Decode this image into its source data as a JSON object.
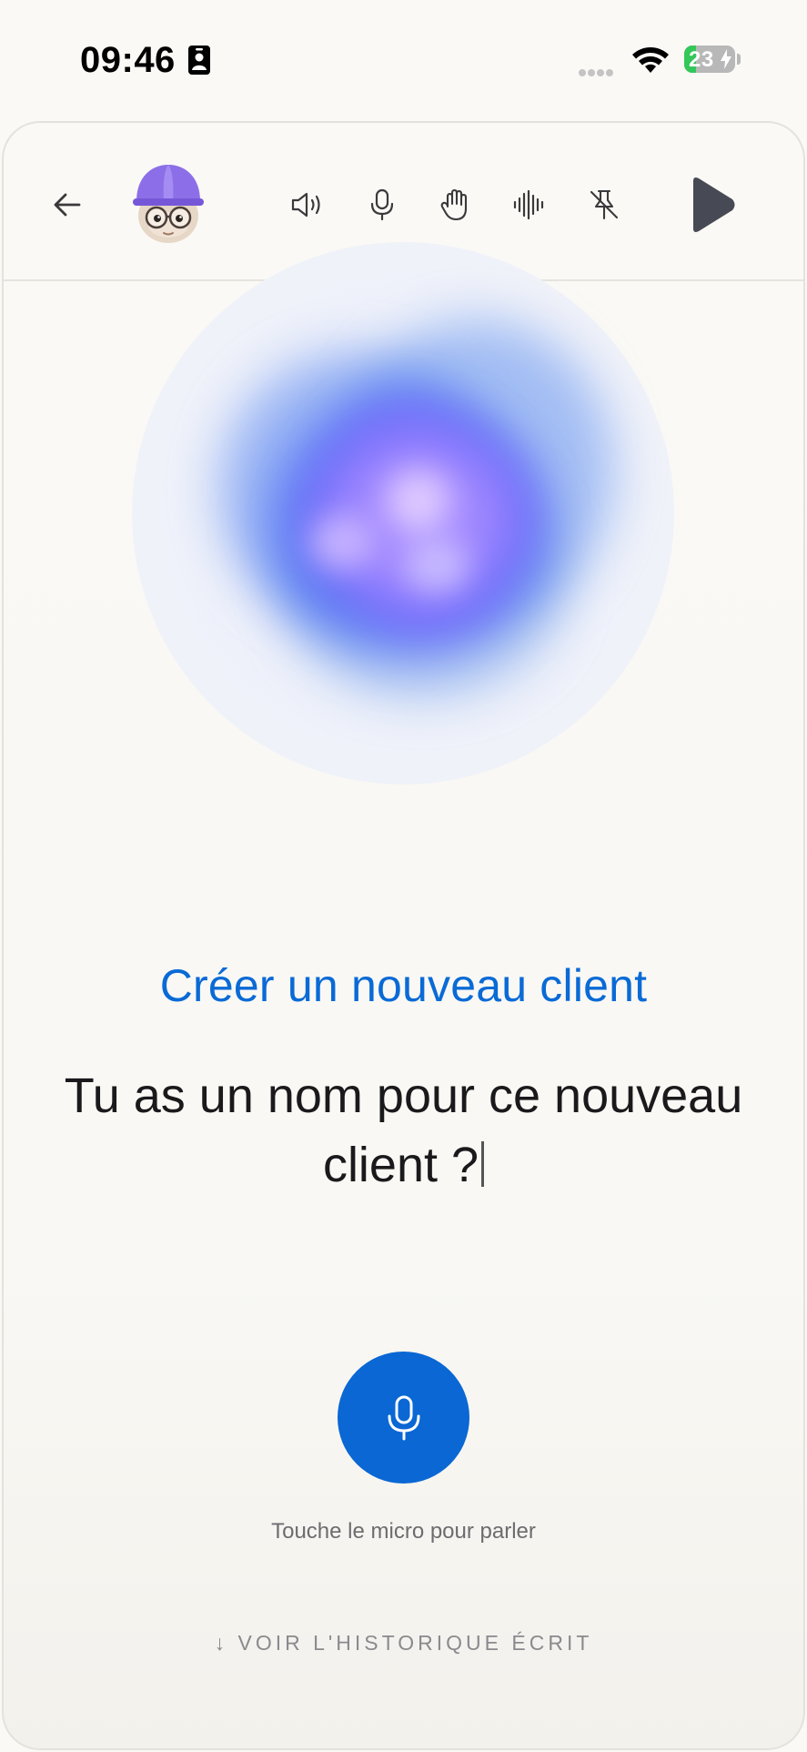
{
  "status_bar": {
    "time": "09:46",
    "battery_percent": "23",
    "battery_level": 0.23,
    "icons": [
      "contact-card-icon",
      "cellular-signal-icon",
      "wifi-icon",
      "battery-charging-icon"
    ]
  },
  "toolbar": {
    "icons": [
      "arrow-left-icon",
      "assistant-avatar",
      "speaker-icon",
      "microphone-icon",
      "hand-raise-icon",
      "waveform-icon",
      "pin-off-icon",
      "play-icon"
    ]
  },
  "main": {
    "flow_title": "Créer un nouveau client",
    "question": "Tu as un nom pour ce nouveau client ?",
    "mic_hint": "Touche le micro pour parler",
    "history_link": "↓ VOIR L'HISTORIQUE ÉCRIT"
  },
  "colors": {
    "accent": "#0a67d4",
    "title": "#0a6ad6",
    "background": "#faf9f5"
  }
}
